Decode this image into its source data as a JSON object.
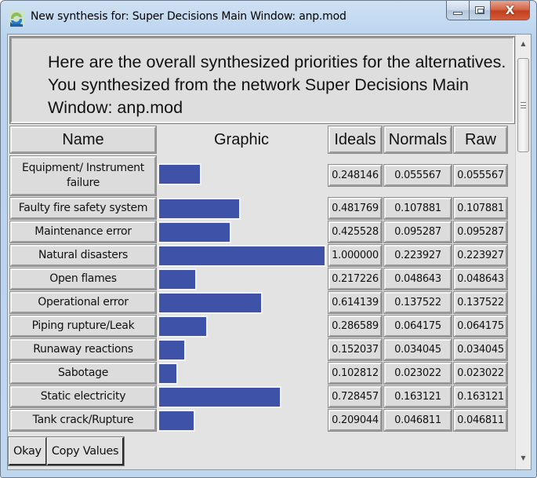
{
  "window": {
    "title": "New synthesis for: Super Decisions Main Window: anp.mod",
    "controls": {
      "minimize": "minimize",
      "maximize": "maximize",
      "close": "X"
    }
  },
  "message": "Here are the overall synthesized priorities for the alternatives.  You synthesized from the network Super Decisions Main Window: anp.mod",
  "table": {
    "headers": {
      "name": "Name",
      "graphic": "Graphic",
      "ideals": "Ideals",
      "normals": "Normals",
      "raw": "Raw"
    },
    "rows": [
      {
        "name": "Equipment/ Instrument failure",
        "ideals": "0.248146",
        "normals": "0.055567",
        "raw": "0.055567",
        "bar_fraction": 0.248146
      },
      {
        "name": "Faulty fire safety system",
        "ideals": "0.481769",
        "normals": "0.107881",
        "raw": "0.107881",
        "bar_fraction": 0.481769
      },
      {
        "name": "Maintenance error",
        "ideals": "0.425528",
        "normals": "0.095287",
        "raw": "0.095287",
        "bar_fraction": 0.425528
      },
      {
        "name": "Natural disasters",
        "ideals": "1.000000",
        "normals": "0.223927",
        "raw": "0.223927",
        "bar_fraction": 1.0
      },
      {
        "name": "Open flames",
        "ideals": "0.217226",
        "normals": "0.048643",
        "raw": "0.048643",
        "bar_fraction": 0.217226
      },
      {
        "name": "Operational error",
        "ideals": "0.614139",
        "normals": "0.137522",
        "raw": "0.137522",
        "bar_fraction": 0.614139
      },
      {
        "name": "Piping rupture/Leak",
        "ideals": "0.286589",
        "normals": "0.064175",
        "raw": "0.064175",
        "bar_fraction": 0.286589
      },
      {
        "name": "Runaway reactions",
        "ideals": "0.152037",
        "normals": "0.034045",
        "raw": "0.034045",
        "bar_fraction": 0.152037
      },
      {
        "name": "Sabotage",
        "ideals": "0.102812",
        "normals": "0.023022",
        "raw": "0.023022",
        "bar_fraction": 0.102812
      },
      {
        "name": "Static electricity",
        "ideals": "0.728457",
        "normals": "0.163121",
        "raw": "0.163121",
        "bar_fraction": 0.728457
      },
      {
        "name": "Tank crack/Rupture",
        "ideals": "0.209044",
        "normals": "0.046811",
        "raw": "0.046811",
        "bar_fraction": 0.209044
      }
    ]
  },
  "buttons": {
    "okay": "Okay",
    "copy_values": "Copy Values"
  },
  "colors": {
    "bar": "#3e52a8",
    "close_button": "#c84a28"
  }
}
